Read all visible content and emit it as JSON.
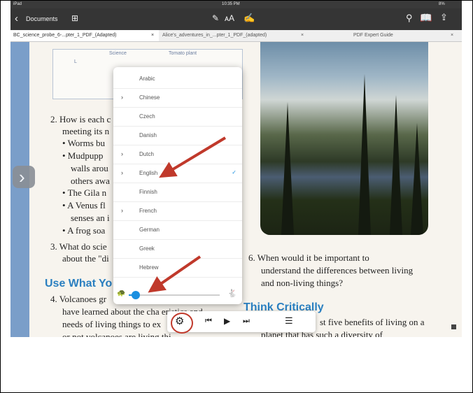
{
  "status": {
    "carrier": "iPad",
    "time": "10:35 PM",
    "battery": "8%"
  },
  "toolbar": {
    "back_label": "Documents"
  },
  "tabs": [
    {
      "label": "BC_science_probe_6-...pter_1_PDF_(Adapted)",
      "close": "×"
    },
    {
      "label": "Alice's_adventures_in_...pter_1_PDF_(adapted)",
      "close": "×"
    },
    {
      "label": "PDF Expert Guide",
      "close": "×"
    }
  ],
  "document": {
    "sketch_labels": [
      "L",
      "Science",
      "Tomato plant"
    ],
    "lines": [
      "2.  How is each c",
      "meeting its n",
      "•  Worms bu",
      "•  Mudpupp",
      "walls arou",
      "others awa",
      "•  The Gila n",
      "•  A Venus fl",
      "senses an i",
      "•  A frog soa",
      "3.  What do scie",
      "about the \"di"
    ],
    "heading_use": "Use What Yo",
    "lines_bottom": [
      "4.  Volcanoes gr",
      "have learned about the cha    eristics and",
      "needs of living things to ex",
      "or not volcanoes are living thi"
    ],
    "q6": [
      "6.  When would it be important to",
      "understand the differences between living",
      "and non-living things?"
    ],
    "heading_think": "Think Critically",
    "right_bottom": [
      "st five benefits of living on a",
      "planet that has such a diversity of"
    ]
  },
  "language_menu": {
    "items": [
      {
        "name": "Arabic",
        "has_submenu": false
      },
      {
        "name": "Chinese",
        "has_submenu": true
      },
      {
        "name": "Czech",
        "has_submenu": false
      },
      {
        "name": "Danish",
        "has_submenu": false
      },
      {
        "name": "Dutch",
        "has_submenu": true
      },
      {
        "name": "English",
        "has_submenu": true,
        "selected": true
      },
      {
        "name": "Finnish",
        "has_submenu": false
      },
      {
        "name": "French",
        "has_submenu": true
      },
      {
        "name": "German",
        "has_submenu": false
      },
      {
        "name": "Greek",
        "has_submenu": false
      },
      {
        "name": "Hebrew",
        "has_submenu": false
      }
    ],
    "check_glyph": "✓",
    "speed_fraction": 0.08
  },
  "icons": {
    "back": "chevron-left-icon",
    "grid": "grid-icon",
    "pen": "pen-icon",
    "text_size": "text-size-icon",
    "edit": "edit-icon",
    "search": "search-icon",
    "bookmarks": "book-icon",
    "share": "share-icon",
    "settings": "gear-icon",
    "previous": "previous-icon",
    "play": "play-icon",
    "next": "next-icon",
    "list": "list-icon"
  },
  "colors": {
    "accent": "#1a8fe0",
    "annotation_red": "#c0392b",
    "heading_blue": "#2a7fc0"
  }
}
